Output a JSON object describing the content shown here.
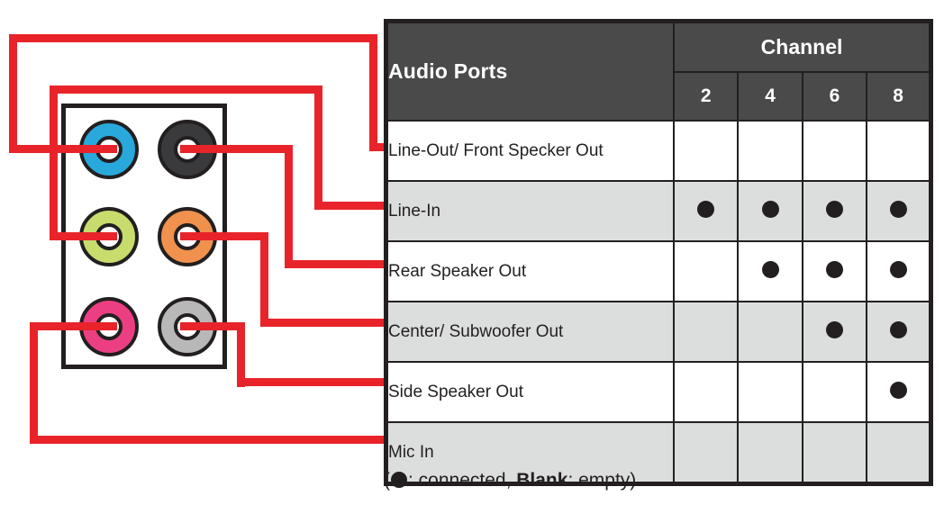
{
  "table": {
    "header": {
      "ports_label": "Audio Ports",
      "channel_label": "Channel",
      "channels": [
        "2",
        "4",
        "6",
        "8"
      ]
    },
    "rows": [
      {
        "label": "Line-Out/ Front Specker Out",
        "connected": [
          false,
          false,
          false,
          false
        ]
      },
      {
        "label": "Line-In",
        "connected": [
          true,
          true,
          true,
          true
        ]
      },
      {
        "label": "Rear Speaker Out",
        "connected": [
          false,
          true,
          true,
          true
        ]
      },
      {
        "label": "Center/ Subwoofer Out",
        "connected": [
          false,
          false,
          true,
          true
        ]
      },
      {
        "label": "Side Speaker Out",
        "connected": [
          false,
          false,
          false,
          true
        ]
      },
      {
        "label": "Mic In",
        "connected": [
          false,
          false,
          false,
          false
        ]
      }
    ]
  },
  "legend": {
    "open_paren": "(",
    "connected_text": ": connected, ",
    "blank_word": "Blank",
    "empty_text": ": empty)"
  },
  "ports": [
    {
      "name": "line-out-front-speaker-jack",
      "color": "#29a8dc"
    },
    {
      "name": "rear-speaker-out-jack",
      "color": "#3a3a3c"
    },
    {
      "name": "line-in-jack",
      "color": "#c8dc6e"
    },
    {
      "name": "center-subwoofer-out-jack",
      "color": "#f0914e"
    },
    {
      "name": "mic-in-jack",
      "color": "#ec3f83"
    },
    {
      "name": "side-speaker-out-jack",
      "color": "#b8b8b8"
    }
  ],
  "colors": {
    "wire": "#e8242a",
    "outline": "#231f20",
    "header_bg": "#4a4a4a",
    "shaded_row": "#dcdede"
  }
}
